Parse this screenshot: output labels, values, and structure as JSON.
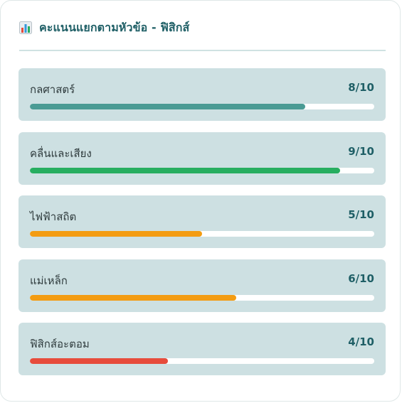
{
  "header": {
    "title": "คะแนนแยกตามหัวข้อ - ฟิสิกส์",
    "icon": "bar-chart-icon"
  },
  "topics": [
    {
      "name": "กลศาสตร์",
      "score": "8/10",
      "fraction": 0.8,
      "color": "#4a9b94"
    },
    {
      "name": "คลื่นและเสียง",
      "score": "9/10",
      "fraction": 0.9,
      "color": "#27ae60"
    },
    {
      "name": "ไฟฟ้าสถิต",
      "score": "5/10",
      "fraction": 0.5,
      "color": "#f39c12"
    },
    {
      "name": "แม่เหล็ก",
      "score": "6/10",
      "fraction": 0.6,
      "color": "#f39c12"
    },
    {
      "name": "ฟิสิกส์อะตอม",
      "score": "4/10",
      "fraction": 0.4,
      "color": "#e74c3c"
    }
  ]
}
